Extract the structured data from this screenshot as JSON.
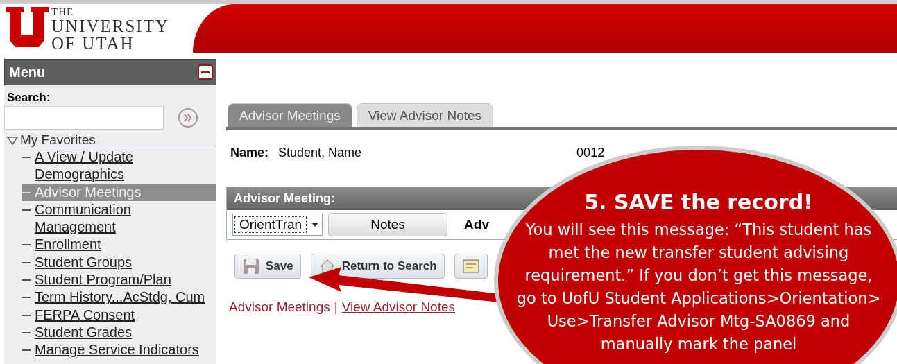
{
  "header": {
    "logo_lines": [
      "THE",
      "UNIVERSITY",
      "OF UTAH"
    ]
  },
  "menu": {
    "title": "Menu",
    "search_label": "Search:",
    "favorites": {
      "label": "My Favorites",
      "expanded": true,
      "children": [
        {
          "label": "A View / Update Demographics",
          "selected": false
        },
        {
          "label": "Advisor Meetings",
          "selected": true
        },
        {
          "label": "Communication Management",
          "selected": false
        },
        {
          "label": "Enrollment",
          "selected": false
        },
        {
          "label": "Student Groups",
          "selected": false
        },
        {
          "label": "Student Program/Plan",
          "selected": false
        },
        {
          "label": "Term History...AcStdg, Cum",
          "selected": false
        },
        {
          "label": "FERPA Consent",
          "selected": false
        },
        {
          "label": "Student Grades",
          "selected": false
        },
        {
          "label": "Manage Service Indicators",
          "selected": false
        }
      ]
    }
  },
  "tabs": [
    {
      "label": "Advisor Meetings",
      "selected": true
    },
    {
      "label": "View Advisor Notes",
      "selected": false
    }
  ],
  "student": {
    "label": "Name:",
    "value": "Student, Name",
    "id": "0012"
  },
  "panel": {
    "title": "Advisor Meeting:",
    "select_value": "OrientTran",
    "notes_button": "Notes",
    "cut_label": "Adv"
  },
  "buttons": [
    {
      "label": "Save",
      "kind": "save"
    },
    {
      "label": "Return to Search",
      "kind": "return"
    },
    {
      "kind": "notify"
    }
  ],
  "links": [
    {
      "label": "Advisor Meetings",
      "selected": true
    },
    {
      "label": "View Advisor Notes",
      "selected": false
    }
  ],
  "link_separator": "|",
  "callout": {
    "title": "5. SAVE the record!",
    "text": "You will see this message: “This student has met the new transfer student advising requirement.”  If you don’t get this message, go to UofU Student Applications>Orientation> Use>Transfer Advisor Mtg-SA0869 and manually mark the panel"
  }
}
